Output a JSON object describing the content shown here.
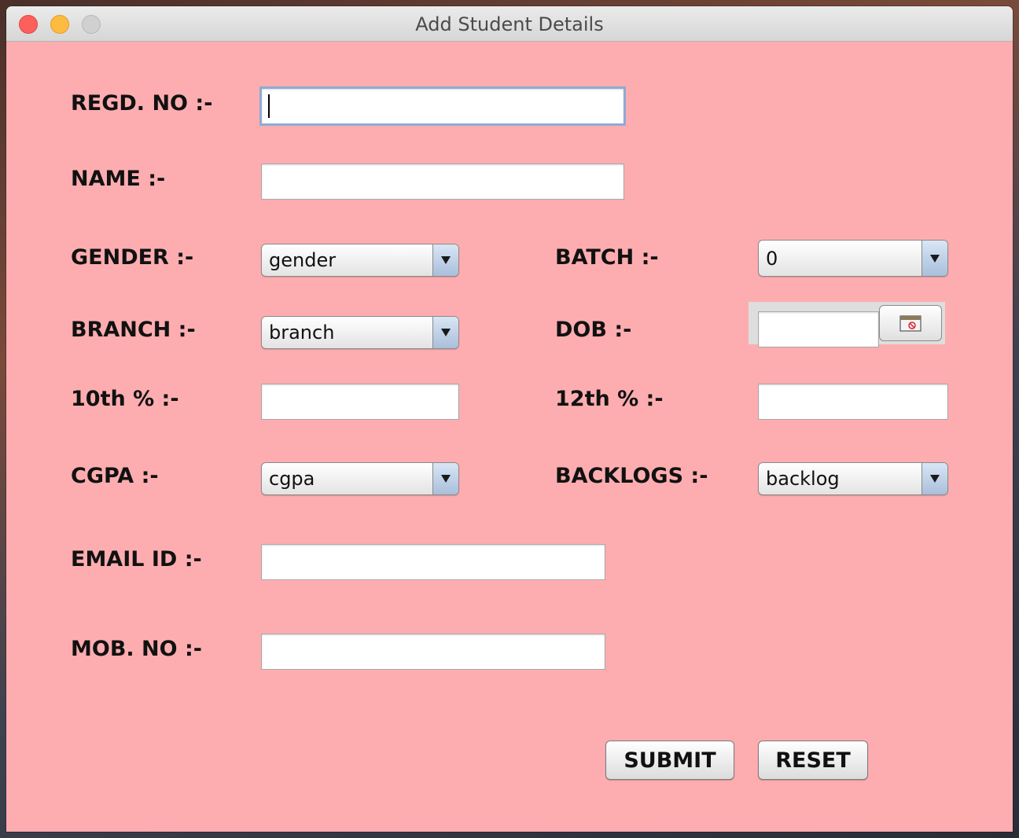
{
  "window": {
    "title": "Add Student Details"
  },
  "form": {
    "regd_no": {
      "label": "REGD. NO :-",
      "value": ""
    },
    "name": {
      "label": "NAME :-",
      "value": ""
    },
    "gender": {
      "label": "GENDER :-",
      "selected": "gender"
    },
    "batch": {
      "label": "BATCH :-",
      "selected": "0"
    },
    "branch": {
      "label": "BRANCH :-",
      "selected": "branch"
    },
    "dob": {
      "label": "DOB :-",
      "value": ""
    },
    "tenth": {
      "label": "10th % :-",
      "value": ""
    },
    "twelfth": {
      "label": "12th % :-",
      "value": ""
    },
    "cgpa": {
      "label": "CGPA :-",
      "selected": "cgpa"
    },
    "backlogs": {
      "label": "BACKLOGS :-",
      "selected": "backlog"
    },
    "email": {
      "label": "EMAIL ID :-",
      "value": ""
    },
    "mobile": {
      "label": "MOB. NO :-",
      "value": ""
    }
  },
  "buttons": {
    "submit": "SUBMIT",
    "reset": "RESET"
  },
  "icons": {
    "close": "close-icon",
    "minimize": "minimize-icon",
    "zoom": "zoom-icon",
    "calendar": "calendar-icon",
    "dropdown": "chevron-down-icon"
  },
  "colors": {
    "form_background": "#fdadb0",
    "close": "#fc605c",
    "minimize": "#fdbc40",
    "focus_ring": "#8cacd6"
  }
}
